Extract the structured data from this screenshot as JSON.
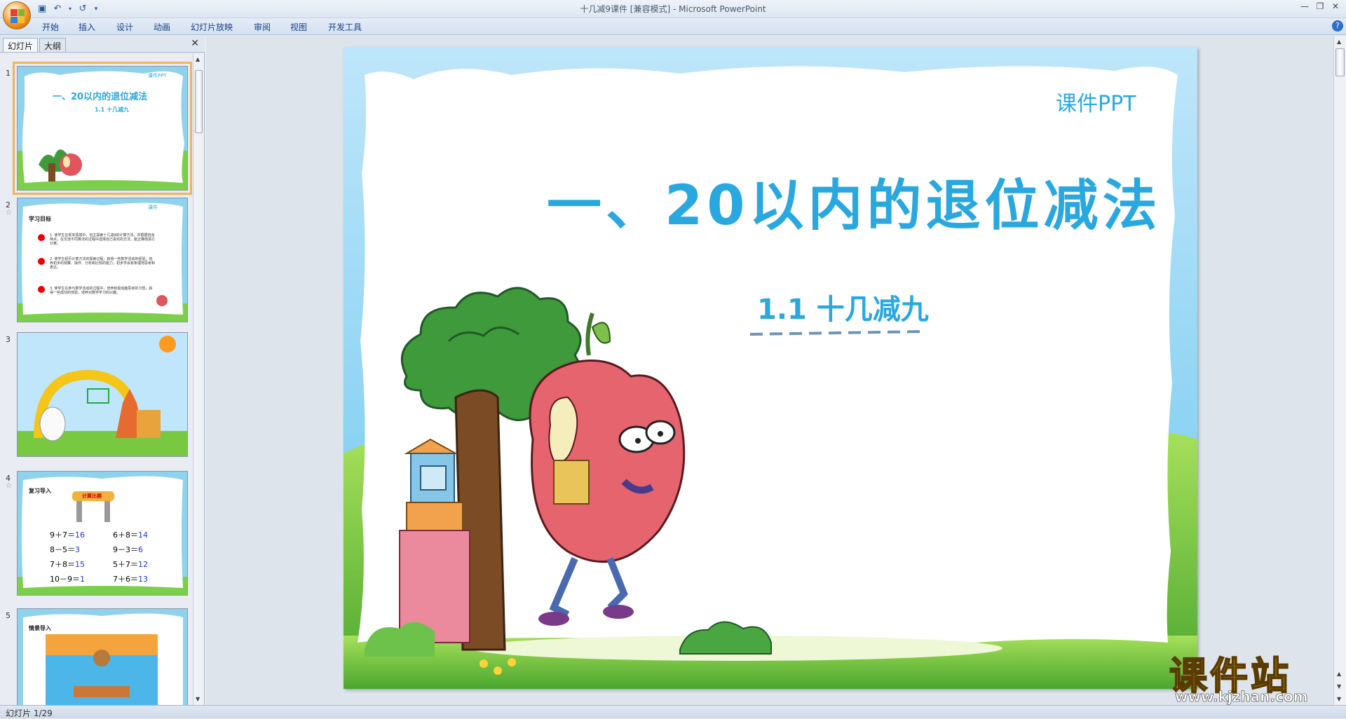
{
  "window": {
    "title": "十几减9课件 [兼容模式] - Microsoft PowerPoint"
  },
  "ribbon": {
    "tabs": [
      "开始",
      "插入",
      "设计",
      "动画",
      "幻灯片放映",
      "审阅",
      "视图",
      "开发工具"
    ]
  },
  "left_pane": {
    "tabs": [
      "幻灯片",
      "大纲"
    ],
    "slides": [
      {
        "number": "1",
        "title": "一、20以内的退位减法",
        "subtitle": "1.1 十几减九",
        "tag": "课件PPT"
      },
      {
        "number": "2",
        "title": "学习目标",
        "points": [
          "1. 使学生在现实情境中，自主探索十几减9的计算方法，并根据自身特点，在交流不同算法的过程中选择自己喜欢的方法，能正确地进行计算。",
          "2. 使学生经历计算方法的探索过程，获得一些数学活动的经验，培养初步的观察、操作、分析和比较的能力，初步学会有条理地思考和表达。",
          "3. 使学生在参与数学活动的过程中，培养积极动脑思考的习惯，获得一些成功的体验，培养对数学学习的兴趣。"
        ]
      },
      {
        "number": "3"
      },
      {
        "number": "4",
        "title": "复习导入",
        "banner": "计算比赛",
        "equations": [
          [
            "9＋7＝",
            "16"
          ],
          [
            "6＋8＝",
            "14"
          ],
          [
            "8－5＝",
            "3"
          ],
          [
            "9－3＝",
            "6"
          ],
          [
            "7＋8＝",
            "15"
          ],
          [
            "5＋7＝",
            "12"
          ],
          [
            "10－9＝",
            "1"
          ],
          [
            "7＋6＝",
            "13"
          ]
        ]
      },
      {
        "number": "5",
        "title": "情景导入"
      }
    ]
  },
  "slide": {
    "tag": "课件PPT",
    "title": "一、20以内的退位减法",
    "subtitle": "1.1 十几减九"
  },
  "status": {
    "slide_counter": "幻灯片 1/29"
  },
  "watermark": {
    "name": "课件站",
    "url": "www.kjzhan.com"
  },
  "colors": {
    "title_blue": "#29a8e0",
    "selection_orange": "#f4b25c",
    "ribbon_text": "#15428b"
  }
}
